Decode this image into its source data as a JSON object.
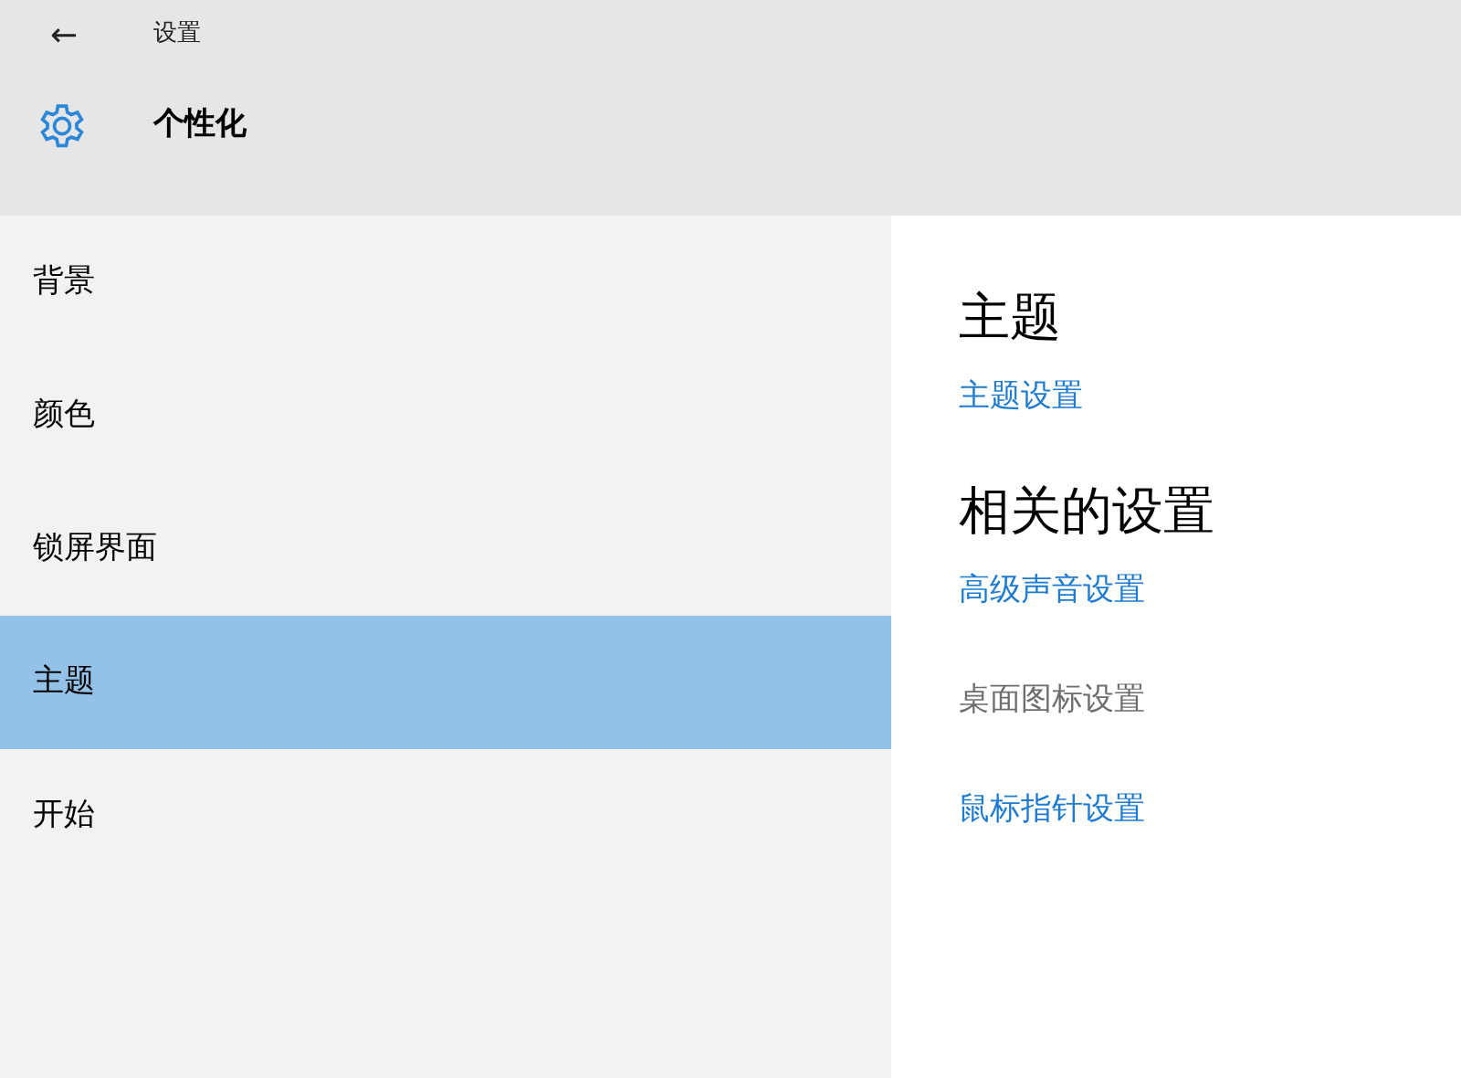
{
  "window": {
    "back": "←",
    "title": "设置"
  },
  "page": {
    "title": "个性化"
  },
  "sidebar": {
    "items": [
      {
        "label": "背景",
        "selected": false
      },
      {
        "label": "颜色",
        "selected": false
      },
      {
        "label": "锁屏界面",
        "selected": false
      },
      {
        "label": "主题",
        "selected": true
      },
      {
        "label": "开始",
        "selected": false
      }
    ]
  },
  "content": {
    "sections": [
      {
        "heading": "主题",
        "links": [
          {
            "label": "主题设置",
            "disabled": false
          }
        ]
      },
      {
        "heading": "相关的设置",
        "links": [
          {
            "label": "高级声音设置",
            "disabled": false
          },
          {
            "label": "桌面图标设置",
            "disabled": true
          },
          {
            "label": "鼠标指针设置",
            "disabled": false
          }
        ]
      }
    ]
  }
}
